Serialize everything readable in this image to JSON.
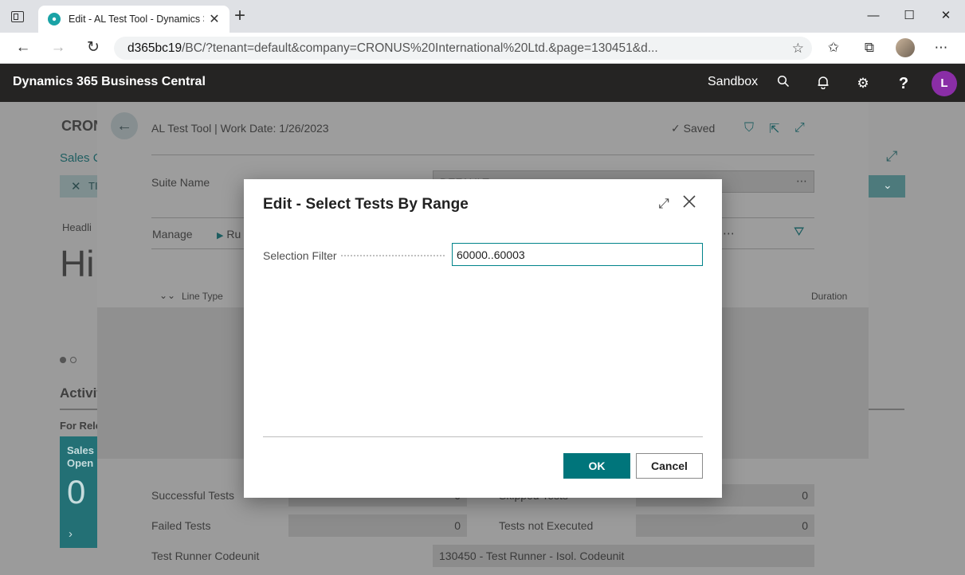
{
  "browser": {
    "tab_title": "Edit - AL Test Tool - Dynamics 365",
    "url_host": "d365bc19",
    "url_path": "/BC/?tenant=default&company=CRONUS%20International%20Ltd.&page=130451&d..."
  },
  "bc_header": {
    "brand": "Dynamics 365 Business Central",
    "environment": "Sandbox",
    "avatar_initial": "L"
  },
  "background": {
    "company_name": "CRON",
    "sales_link": "Sales C",
    "filter_chip": "TI",
    "headline_label": "Headli",
    "greeting": "Hi",
    "activities_heading": "Activit",
    "for_release": "For Rele",
    "tile_label_1": "Sales C",
    "tile_label_2": "Open",
    "tile_value": "0"
  },
  "tool_page": {
    "header": "AL Test Tool | Work Date: 1/26/2023",
    "saved_label": "Saved",
    "suite_name_label": "Suite Name",
    "suite_name_value": "DEFAULT",
    "manage_label": "Manage",
    "run_label": "Ru",
    "col_line_type": "Line Type",
    "col_duration": "Duration",
    "successful_tests_label": "Successful Tests",
    "successful_tests_value": "0",
    "skipped_tests_label": "Skipped Tests",
    "skipped_tests_value": "0",
    "failed_tests_label": "Failed Tests",
    "failed_tests_value": "0",
    "tests_not_executed_label": "Tests not Executed",
    "tests_not_executed_value": "0",
    "test_runner_label": "Test Runner Codeunit",
    "test_runner_value": "130450 - Test Runner - Isol. Codeunit"
  },
  "dialog": {
    "title": "Edit - Select Tests By Range",
    "selection_filter_label": "Selection Filter",
    "selection_filter_value": "60000..60003",
    "ok_label": "OK",
    "cancel_label": "Cancel"
  }
}
